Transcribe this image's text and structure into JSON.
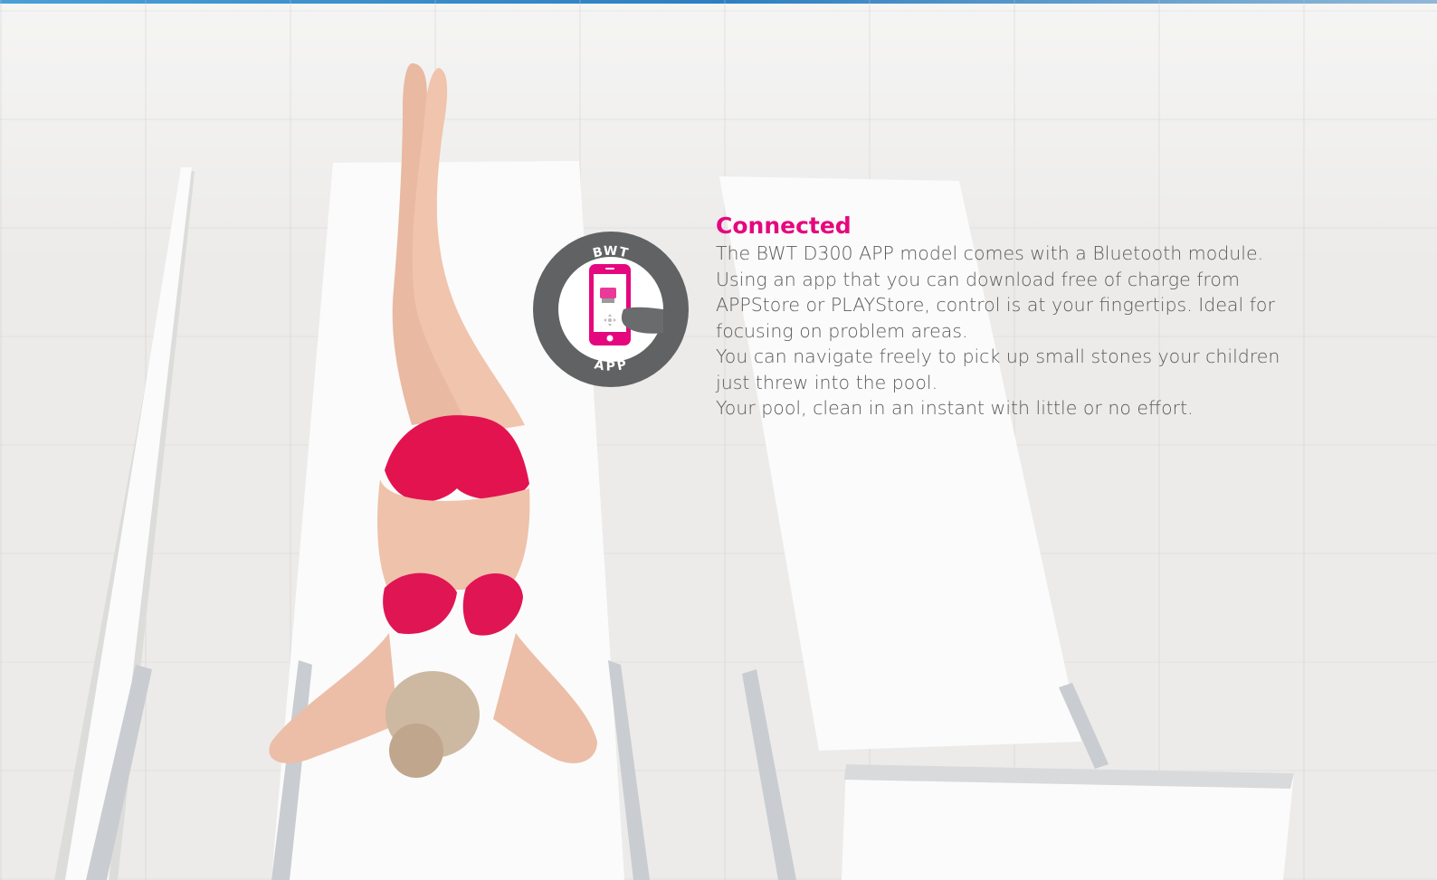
{
  "section": {
    "heading": "Connected",
    "paragraphs": [
      "The BWT D300 APP model comes with a Bluetooth module.",
      "Using an app that you can download free of charge from",
      "APPStore or PLAYStore, control is at your fingertips. Ideal for",
      "focusing on problem areas.",
      "You can navigate freely to pick up small stones your children",
      "just threw into the pool.",
      "Your pool, clean in an instant with little or no effort."
    ]
  },
  "badge": {
    "top_label": "BWT",
    "bottom_label": "APP",
    "icon": "smartphone-app-icon"
  },
  "colors": {
    "accent": "#e5077e",
    "badge_ring": "#616263",
    "text": "#5a5a5a"
  }
}
